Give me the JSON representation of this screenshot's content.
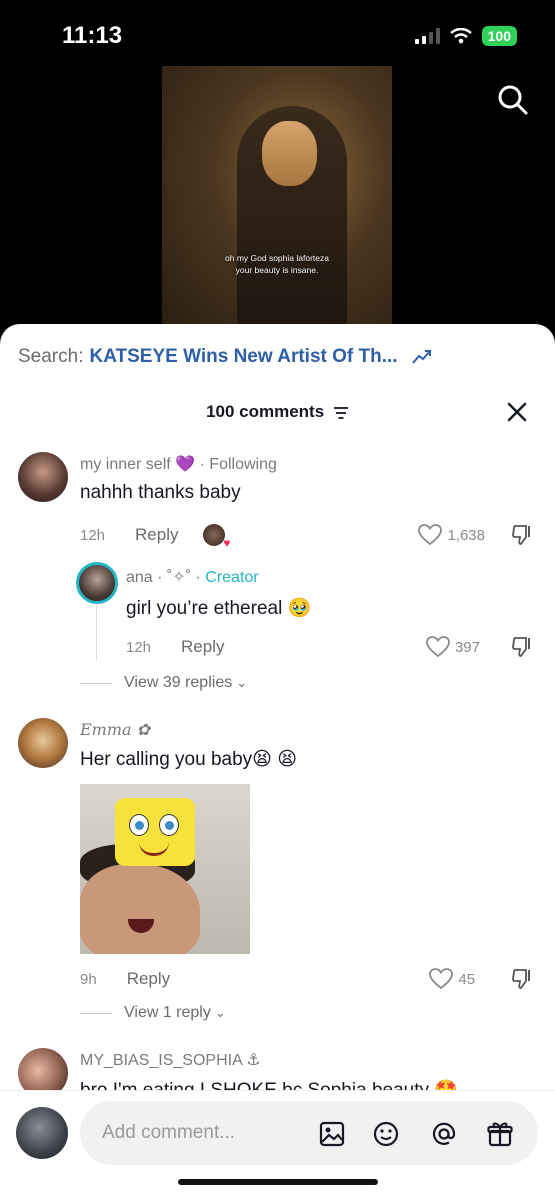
{
  "status_bar": {
    "time": "11:13",
    "battery": "100"
  },
  "video": {
    "caption_line1": "oh my God sophia laforteza",
    "caption_line2": "your beauty is insane."
  },
  "search": {
    "prefix": "Search:",
    "query": "KATSEYE Wins New Artist Of Th..."
  },
  "header": {
    "title": "100 comments"
  },
  "comments": [
    {
      "username": "my inner self",
      "badge": "· Following",
      "text": "nahhh thanks baby",
      "time": "12h",
      "reply_label": "Reply",
      "likes": "1,638",
      "reply": {
        "username": "ana · ˚✧˚ ·",
        "creator_label": "Creator",
        "text": "girl you’re ethereal 🥹",
        "time": "12h",
        "reply_label": "Reply",
        "likes": "397"
      },
      "view_replies": "View 39 replies"
    },
    {
      "username": "Emma ✿",
      "text": "Her calling you baby😫 😫",
      "time": "9h",
      "reply_label": "Reply",
      "likes": "45",
      "view_replies": "View 1 reply"
    },
    {
      "username": "MY_BIAS_IS_SOPHIA",
      "text": "bro I'm eating I SHOKE bc Sophia beauty 🤩"
    }
  ],
  "composer": {
    "placeholder": "Add comment..."
  },
  "colors": {
    "creator": "#22b6c6",
    "search_query": "#2f5fa6",
    "heart": "#9a9a9a"
  }
}
